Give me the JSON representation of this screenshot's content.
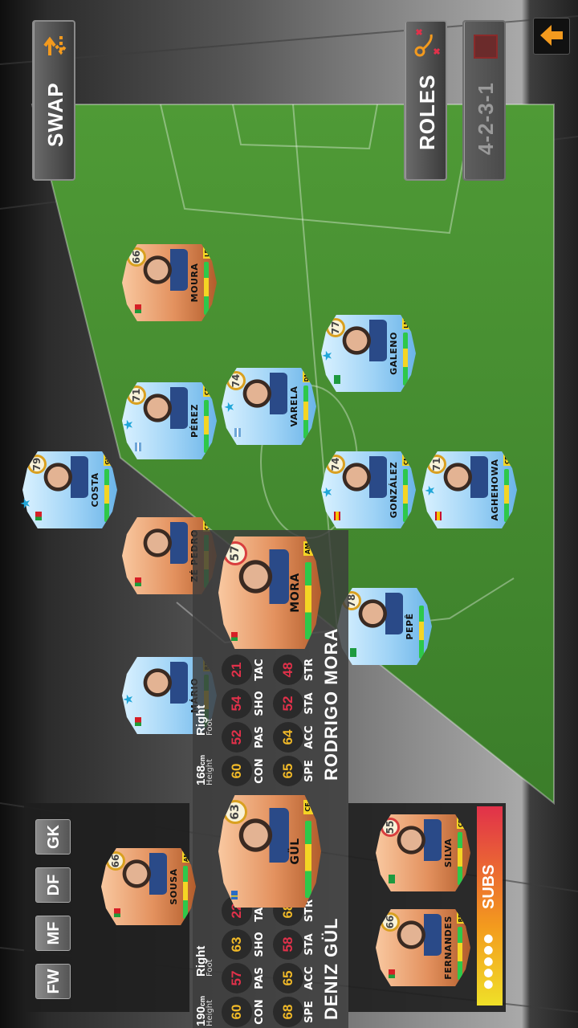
{
  "toolbar": {
    "swap_label": "SWAP",
    "roles_label": "ROLES",
    "formation_label": "4-2-3-1"
  },
  "players": [
    {
      "name": "COSTA",
      "position": "GK",
      "rating": "79",
      "flag": "pt"
    },
    {
      "name": "PÉREZ",
      "position": "CB",
      "rating": "71",
      "flag": "ar"
    },
    {
      "name": "MOURA",
      "position": "LB",
      "rating": "66",
      "flag": "pt"
    },
    {
      "name": "VARELA",
      "position": "DM",
      "rating": "74",
      "flag": "ar"
    },
    {
      "name": "GALENO",
      "position": "LM",
      "rating": "77",
      "flag": "br"
    },
    {
      "name": "GONZÁLEZ",
      "position": "CM",
      "rating": "74",
      "flag": "es"
    },
    {
      "name": "AGHEHOWA",
      "position": "CF",
      "rating": "71",
      "flag": "es"
    },
    {
      "name": "ZÉ PEDRO",
      "position": "CB",
      "rating": "",
      "flag": "pt"
    },
    {
      "name": "PEPÊ",
      "position": "",
      "rating": "78",
      "flag": "br"
    },
    {
      "name": "MÁRIO",
      "position": "RB",
      "rating": "",
      "flag": "pt"
    }
  ],
  "compare": [
    {
      "name": "RODRIGO MORA",
      "card": {
        "name": "MORA",
        "position": "AM",
        "rating": "57",
        "flag": "pt"
      },
      "stat_labels": [
        "SPE",
        "ACC",
        "STA",
        "STR",
        "CON",
        "PAS",
        "SHO",
        "TAC"
      ],
      "stats": [
        "65",
        "64",
        "52",
        "48",
        "60",
        "52",
        "54",
        "21"
      ],
      "height_label": "Height",
      "height_value": "168",
      "height_unit": "cm",
      "foot_label": "Foot",
      "foot_value": "Right"
    },
    {
      "name": "DENIZ GÜL",
      "card": {
        "name": "GÜL",
        "position": "CF",
        "rating": "63",
        "flag": "se"
      },
      "stat_labels": [
        "SPE",
        "ACC",
        "STA",
        "STR",
        "CON",
        "PAS",
        "SHO",
        "TAC"
      ],
      "stats": [
        "68",
        "65",
        "58",
        "68",
        "60",
        "57",
        "63",
        "22"
      ],
      "height_label": "Height",
      "height_value": "190",
      "height_unit": "cm",
      "foot_label": "Foot",
      "foot_value": "Right"
    }
  ],
  "subs": {
    "label": "SUBS",
    "dots": "●●●●●",
    "players": [
      {
        "name": "SILVA",
        "position": "CB",
        "rating": "55",
        "flag": "br"
      },
      {
        "name": "FERNANDES",
        "position": "RB",
        "rating": "66",
        "flag": "pt"
      }
    ]
  },
  "reserve": {
    "player": {
      "name": "SOUSA",
      "position": "AM",
      "rating": "66",
      "flag": "pt"
    },
    "filters": [
      "GK",
      "DF",
      "MF",
      "FW"
    ]
  },
  "icons": {
    "swap": "swap-arrows-icon",
    "roles": "tactics-icon",
    "formation": "formation-icon",
    "scroll_up": "arrow-up-icon"
  },
  "colors": {
    "accent": "#f39a1e",
    "rating_yellow": "#f0b928",
    "rating_red": "#e1314a",
    "card_blue": "#9fd3f6",
    "card_orange": "#e3915e"
  }
}
